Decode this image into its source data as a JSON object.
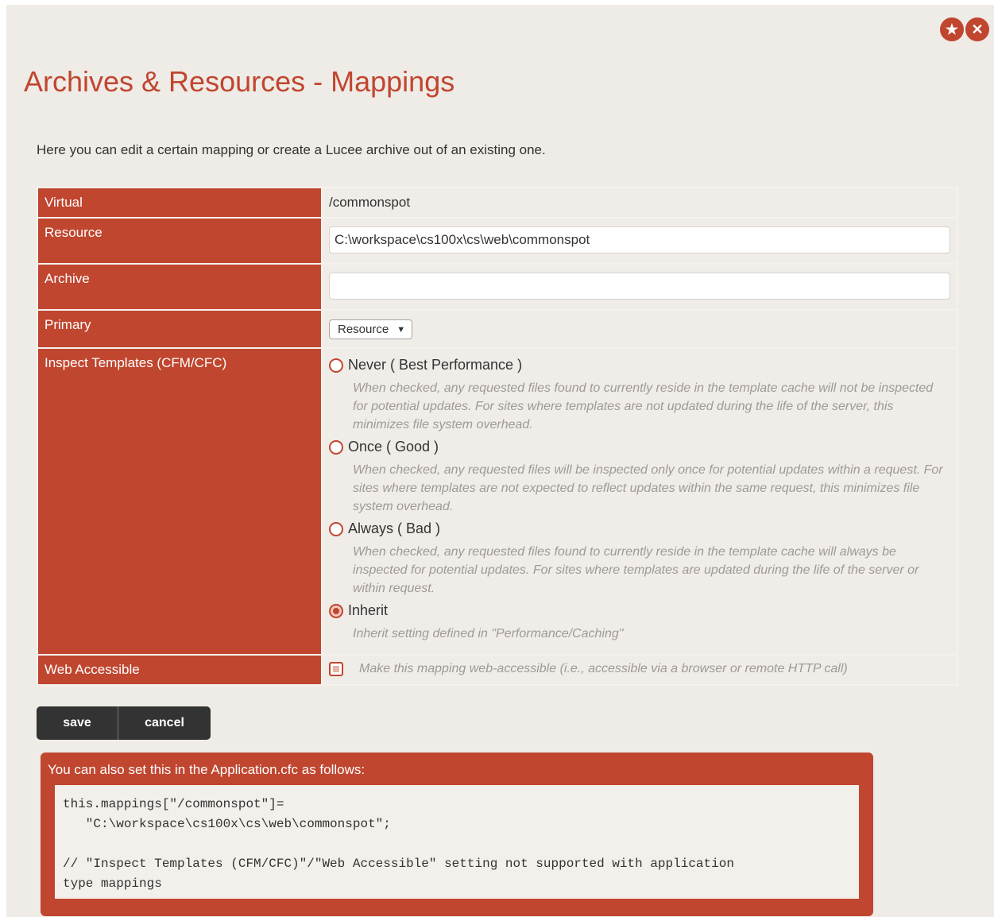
{
  "page_title": "Archives & Resources - Mappings",
  "intro": "Here you can edit a certain mapping or create a Lucee archive out of an existing one.",
  "icons": {
    "favorite": "star-icon",
    "close": "close-icon"
  },
  "colors": {
    "accent": "#c0462f",
    "background": "#efebe6",
    "button": "#333333"
  },
  "form": {
    "virtual": {
      "label": "Virtual",
      "value": "/commonspot"
    },
    "resource": {
      "label": "Resource",
      "value": "C:\\workspace\\cs100x\\cs\\web\\commonspot"
    },
    "archive": {
      "label": "Archive",
      "value": ""
    },
    "primary": {
      "label": "Primary",
      "selected": "Resource"
    },
    "inspect": {
      "label": "Inspect Templates (CFM/CFC)",
      "options": [
        {
          "label": "Never ( Best Performance )",
          "description": "When checked, any requested files found to currently reside in the template cache will not be inspected for potential updates. For sites where templates are not updated during the life of the server, this minimizes file system overhead.",
          "checked": false
        },
        {
          "label": "Once ( Good )",
          "description": "When checked, any requested files will be inspected only once for potential updates within a request. For sites where templates are not expected to reflect updates within the same request, this minimizes file system overhead.",
          "checked": false
        },
        {
          "label": "Always ( Bad )",
          "description": "When checked, any requested files found to currently reside in the template cache will always be inspected for potential updates. For sites where templates are updated during the life of the server or within request.",
          "checked": false
        },
        {
          "label": "Inherit",
          "description": "Inherit setting defined in \"Performance/Caching\"",
          "checked": true
        }
      ]
    },
    "web_accessible": {
      "label": "Web Accessible",
      "description": "Make this mapping web-accessible (i.e., accessible via a browser or remote HTTP call)",
      "checked": false
    }
  },
  "buttons": {
    "save": "save",
    "cancel": "cancel"
  },
  "code_box": {
    "title": "You can also set this in the Application.cfc as follows:",
    "code": "this.mappings[\"/commonspot\"]=\n   \"C:\\workspace\\cs100x\\cs\\web\\commonspot\";\n\n// \"Inspect Templates (CFM/CFC)\"/\"Web Accessible\" setting not supported with application\ntype mappings"
  }
}
